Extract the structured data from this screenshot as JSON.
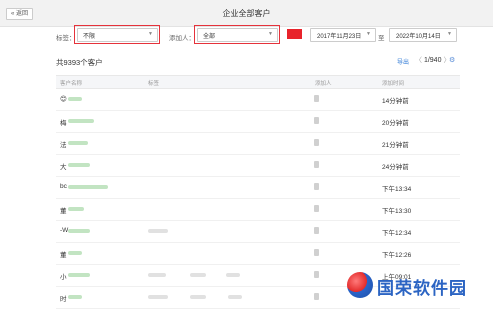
{
  "header": {
    "back_label": "« 返回",
    "title": "企业全部客户"
  },
  "filters": {
    "tag_label": "标签：",
    "tag_value": "不限",
    "adder_label": "添加人：",
    "adder_value": "全部",
    "highlight_color": "#e8232b",
    "date_from": "2017年11月23日",
    "date_to_label": "至",
    "date_to": "2022年10月14日"
  },
  "summary": {
    "count_text": "共9393个客户",
    "export_label": "导出",
    "page_prev": "〈",
    "page_text": "1/940",
    "page_next": "〉",
    "settings_icon": "⚙"
  },
  "table": {
    "headers": [
      "客户名称",
      "标签",
      "添加人",
      "添加时间"
    ],
    "rows": [
      {
        "name": "😊",
        "time": "14分钟前"
      },
      {
        "name": "梅",
        "time": "20分钟前"
      },
      {
        "name": "法",
        "time": "21分钟前"
      },
      {
        "name": "大",
        "time": "24分钟前"
      },
      {
        "name": "bc",
        "time": "下午13:34"
      },
      {
        "name": "董",
        "time": "下午13:30"
      },
      {
        "name": "-W",
        "time": "下午12:34"
      },
      {
        "name": "董",
        "time": "下午12:26"
      },
      {
        "name": "小",
        "time": "上午09:01"
      },
      {
        "name": "时",
        "time": ""
      }
    ]
  },
  "watermark": {
    "text": "国荣软件园"
  }
}
